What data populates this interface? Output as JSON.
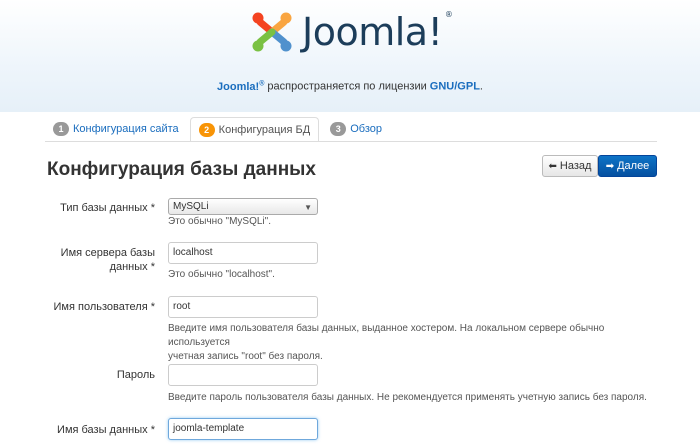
{
  "header": {
    "logo_text": "Joomla!",
    "logo_reg": "®",
    "license": {
      "brand": "Joomla!",
      "reg": "®",
      "text": " распространяется по лицензии ",
      "license_name": "GNU/GPL",
      "end": "."
    }
  },
  "tabs": [
    {
      "num": "1",
      "label": "Конфигурация сайта",
      "active": false
    },
    {
      "num": "2",
      "label": "Конфигурация БД",
      "active": true
    },
    {
      "num": "3",
      "label": "Обзор",
      "active": false
    }
  ],
  "page": {
    "title": "Конфигурация базы данных",
    "back_label": "Назад",
    "next_label": "Далее"
  },
  "form": {
    "db_type": {
      "label": "Тип базы данных *",
      "value": "MySQLi",
      "help": "Это обычно \"MySQLi\"."
    },
    "host": {
      "label_line1": "Имя сервера базы",
      "label_line2": "данных *",
      "value": "localhost",
      "help": "Это обычно \"localhost\"."
    },
    "user": {
      "label": "Имя пользователя *",
      "value": "root",
      "help_line1": "Введите имя пользователя базы данных, выданное хостером. На локальном сервере обычно используется",
      "help_line2": "учетная запись \"root\" без пароля."
    },
    "password": {
      "label": "Пароль",
      "value": "",
      "help": "Введите пароль пользователя базы данных. Не рекомендуется применять учетную запись без пароля."
    },
    "db_name": {
      "label": "Имя базы данных *",
      "value": "joomla-template"
    }
  },
  "colors": {
    "accent": "#1a6dbe",
    "primary_button": "#0a62b8",
    "badge_active": "#f89406"
  }
}
